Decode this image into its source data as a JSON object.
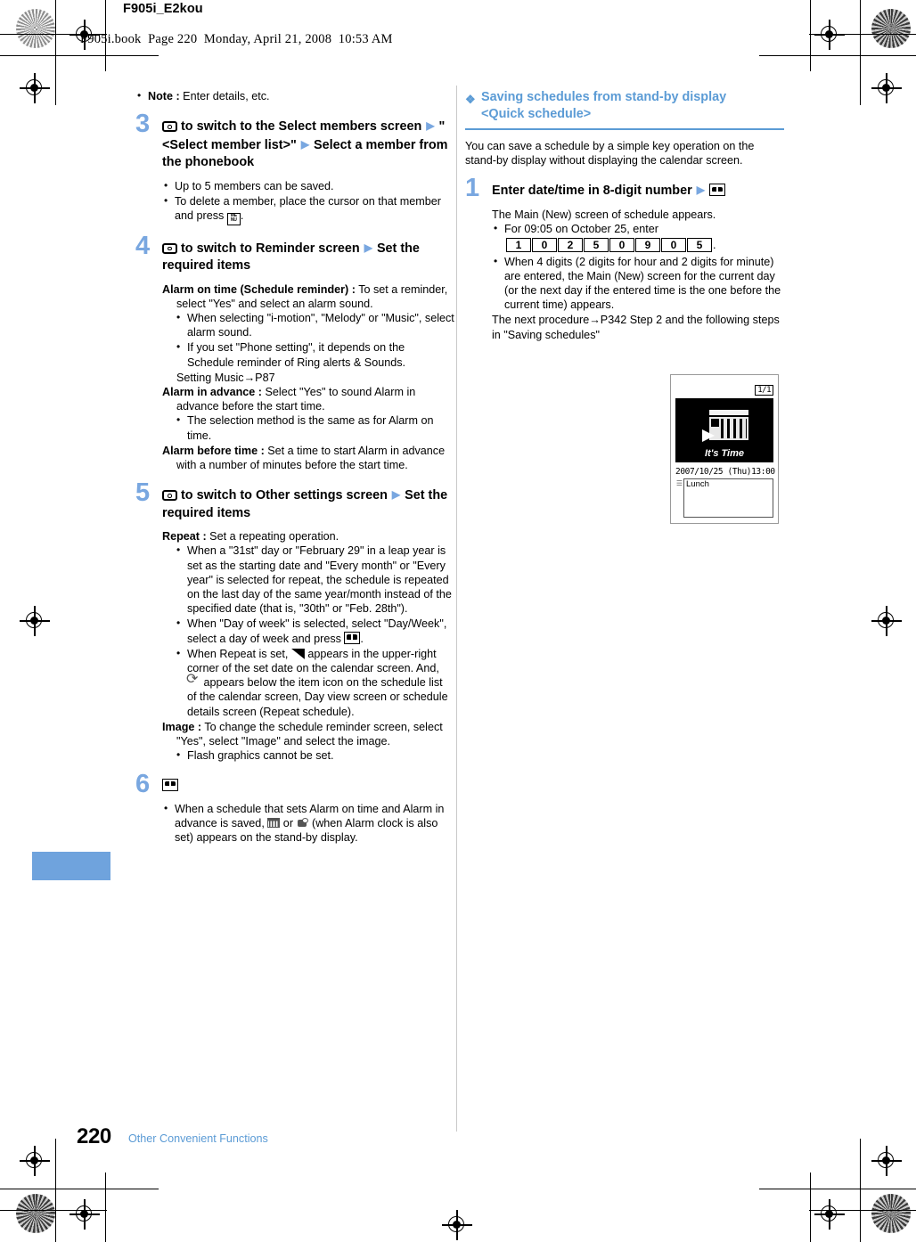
{
  "header": {
    "doc_title": "F905i_E2kou",
    "book_line": "F905i.book  Page 220  Monday, April 21, 2008  10:53 AM"
  },
  "footer": {
    "page_number": "220",
    "chapter": "Other Convenient Functions"
  },
  "colors": {
    "accent_blue": "#5b9bd5",
    "step_number_blue": "#79a7e0",
    "thumb_tab_blue": "#6fa3dd"
  },
  "left_column": {
    "note_bullet": {
      "lead": "Note :",
      "text": " Enter details, etc."
    },
    "step3": {
      "number": "3",
      "head_part1": " to switch to the Select members screen ",
      "head_part2": " \"<Select member list>\" ",
      "head_part3": " Select a member from the phonebook",
      "bullets": [
        "Up to 5 members can be saved.",
        "To delete a member, place the cursor on that member and press "
      ],
      "bullet2_tail": "."
    },
    "step4": {
      "number": "4",
      "head_part1": " to switch to Reminder screen ",
      "head_part2": " Set the required items",
      "defs": [
        {
          "term": "Alarm on time (Schedule reminder) :",
          "desc": " To set a reminder, select \"Yes\" and select an alarm sound.",
          "bullets": [
            "When selecting \"i-motion\", \"Melody\" or \"Music\", select alarm sound.",
            "If you set \"Phone setting\", it depends on the Schedule reminder of Ring alerts & Sounds."
          ],
          "tail": "Setting Music→P87"
        },
        {
          "term": "Alarm in advance :",
          "desc": " Select \"Yes\" to sound Alarm in advance before the start time.",
          "bullets": [
            "The selection method is the same as for Alarm on time."
          ],
          "tail": ""
        },
        {
          "term": "Alarm before time :",
          "desc": " Set a time to start Alarm in advance with a number of minutes before the start time.",
          "bullets": [],
          "tail": ""
        }
      ]
    },
    "step5": {
      "number": "5",
      "head_part1": " to switch to Other settings screen ",
      "head_part2": " Set the required items",
      "repeat_term": "Repeat :",
      "repeat_desc": " Set a repeating operation.",
      "repeat_bullet1": "When a \"31st\" day or \"February 29\" in a leap year is set as the starting date and \"Every month\" or \"Every year\" is selected for repeat, the schedule is repeated on the last day of the same year/month instead of the specified date (that is, \"30th\" or \"Feb. 28th\").",
      "repeat_bullet2_pre": "When \"Day of week\" is selected, select \"Day/Week\", select a day of week and press ",
      "repeat_bullet2_post": ".",
      "repeat_bullet3_pre": "When Repeat is set, ",
      "repeat_bullet3_mid": " appears in the upper-right corner of the set date on the calendar screen. And, ",
      "repeat_bullet3_post": " appears below the item icon on the schedule list of the calendar screen, Day view screen or schedule details screen (Repeat schedule).",
      "image_term": "Image :",
      "image_desc": " To change the schedule reminder screen, select \"Yes\", select \"Image\" and select the image.",
      "image_bullet": "Flash graphics cannot be set."
    },
    "step6": {
      "number": "6",
      "bullet_pre": "When a schedule that sets Alarm on time and Alarm in advance is saved, ",
      "bullet_mid": " or ",
      "bullet_post": " (when Alarm clock is also set) appears on the stand-by display."
    }
  },
  "right_column": {
    "section": {
      "diamond": "❖",
      "title_line1": "Saving schedules from stand-by display",
      "title_line2": "<Quick schedule>"
    },
    "intro": "You can save a schedule by a simple key operation on the stand-by display without displaying the calendar screen.",
    "step1": {
      "number": "1",
      "head": "Enter date/time in 8-digit number ",
      "lead_text": "The Main (New) screen of schedule appears.",
      "bullet1": "For 09:05 on October 25, enter",
      "keys": [
        "1",
        "0",
        "2",
        "5",
        "0",
        "9",
        "0",
        "5"
      ],
      "keys_tail": ".",
      "bullet2": "When 4 digits (2 digits for hour and 2 digits for minute) are entered, the Main (New) screen for the current day (or the next day if the entered time is the one before the current time) appears.",
      "tail": "The next procedure→P342 Step 2 and the following steps in \"Saving schedules\""
    },
    "figure": {
      "counter": "1/1",
      "screen_label": "It's Time",
      "date_line": "2007/10/25 (Thu)13:00",
      "memo_text": "Lunch"
    }
  },
  "icons": {
    "select_key": "select-key-icon",
    "menu_key": "menu-key-icon",
    "book_key": "book-key-icon",
    "repeat_corner": "repeat-corner-icon",
    "repeat_arrows": "repeat-arrows-icon",
    "calendar_small": "calendar-icon",
    "alarm_clock": "alarm-clock-icon"
  }
}
